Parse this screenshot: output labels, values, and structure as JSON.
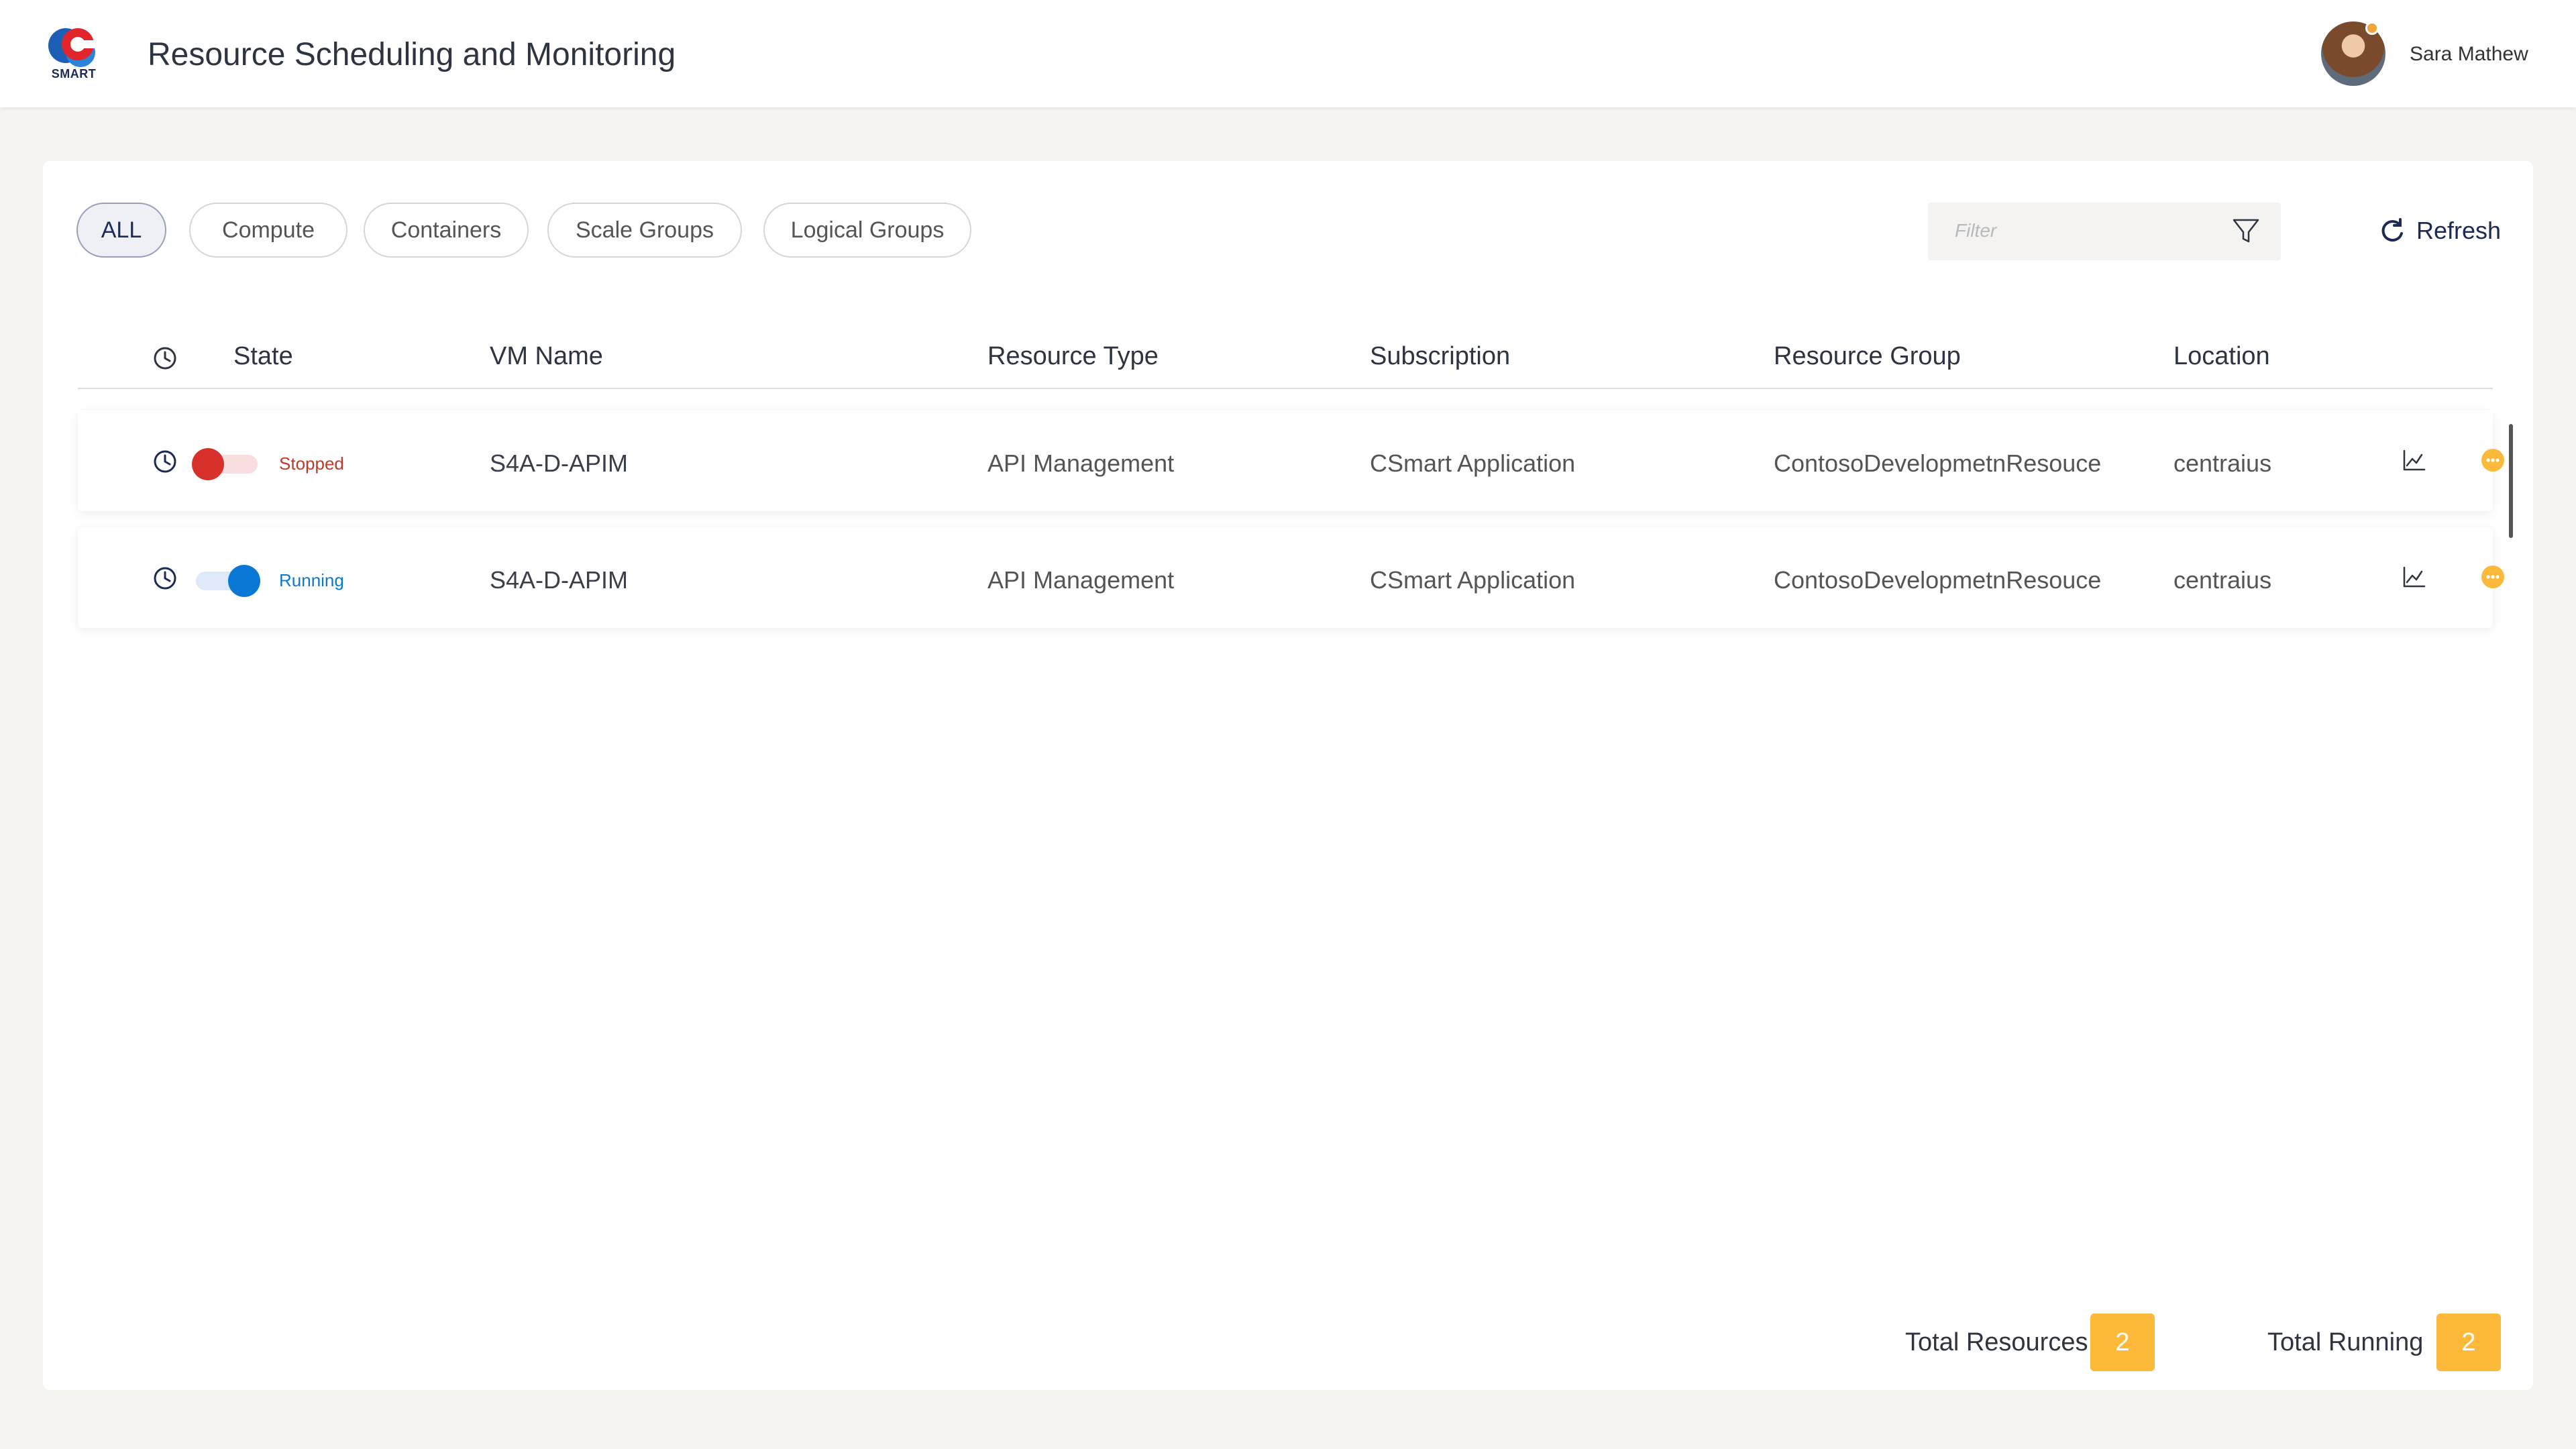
{
  "header": {
    "logo_text": "SMART",
    "title": "Resource Scheduling and Monitoring",
    "user_name": "Sara Mathew"
  },
  "colors": {
    "accent": "#1c2a55",
    "running": "#0a78d4",
    "stopped": "#d8302a",
    "badge": "#fdba3a"
  },
  "tabs": [
    {
      "label": "ALL",
      "active": true
    },
    {
      "label": "Compute",
      "active": false
    },
    {
      "label": "Containers",
      "active": false
    },
    {
      "label": "Scale Groups",
      "active": false
    },
    {
      "label": "Logical Groups",
      "active": false
    }
  ],
  "filter": {
    "placeholder": "Filter",
    "icon": "filter-icon"
  },
  "refresh": {
    "label": "Refresh",
    "icon": "refresh-icon"
  },
  "table": {
    "columns": [
      "State",
      "VM Name",
      "Resource Type",
      "Subscription",
      "Resource Group",
      "Location"
    ],
    "rows": [
      {
        "state": "off",
        "status": "Stopped",
        "vm_name": "S4A-D-APIM",
        "resource_type": "API Management",
        "subscription": "CSmart Application",
        "resource_group": "ContosoDevelopmetnResouce",
        "location": "centraius"
      },
      {
        "state": "on",
        "status": "Running",
        "vm_name": "S4A-D-APIM",
        "resource_type": "API Management",
        "subscription": "CSmart Application",
        "resource_group": "ContosoDevelopmetnResouce",
        "location": "centraius"
      }
    ]
  },
  "totals": {
    "resources_label": "Total Resources",
    "resources_value": "2",
    "running_label": "Total Running",
    "running_value": "2"
  }
}
